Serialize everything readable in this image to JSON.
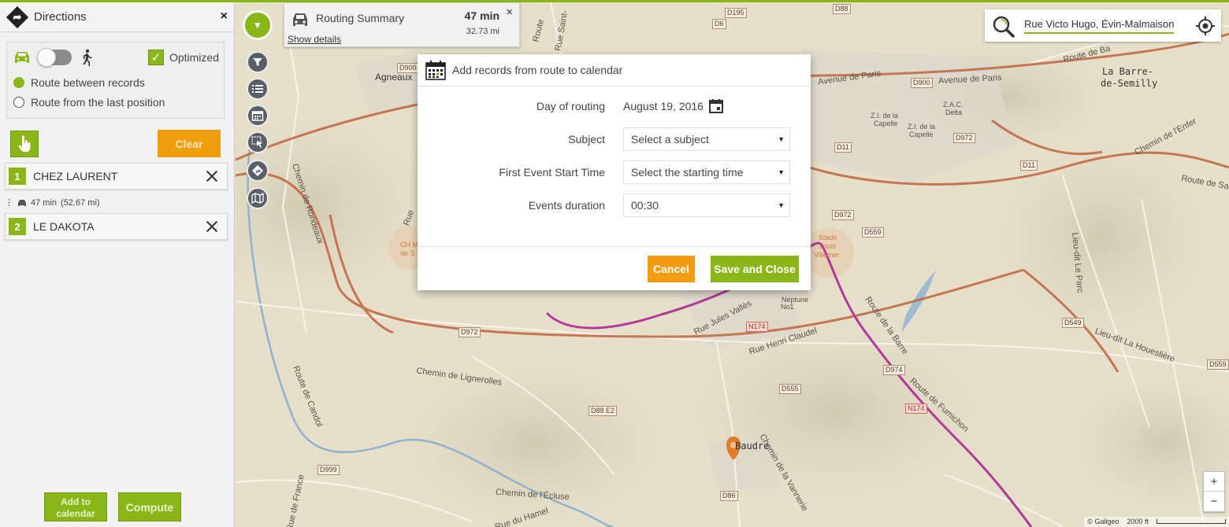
{
  "directions": {
    "title": "Directions",
    "close": "×",
    "optimized_label": "Optimized",
    "optimized_checked": true,
    "route_options": [
      {
        "label": "Route between records",
        "selected": true
      },
      {
        "label": "Route from the last position",
        "selected": false
      }
    ],
    "clear_label": "Clear",
    "stops": [
      {
        "num": "1",
        "name": "CHEZ LAURENT"
      },
      {
        "num": "2",
        "name": "LE DAKOTA"
      }
    ],
    "leg": {
      "time": "47 min",
      "distance": "(52.67 mi)"
    },
    "add_to_calendar_label": "Add to calendar",
    "compute_label": "Compute"
  },
  "routing_summary": {
    "title": "Routing Summary",
    "time": "47 min",
    "distance": "32.73 mi",
    "details_link": "Show details",
    "close": "×"
  },
  "search": {
    "value": "Rue Victo Hugo, Évin-Malmaison, L"
  },
  "modal": {
    "title": "Add records from route to calendar",
    "day_label": "Day of routing",
    "day_value": "August 19, 2016",
    "subject_label": "Subject",
    "subject_value": "Select a subject",
    "start_label": "First Event Start Time",
    "start_value": "Select the starting time",
    "duration_label": "Events duration",
    "duration_value": "00:30",
    "cancel_label": "Cancel",
    "save_label": "Save and Close"
  },
  "map": {
    "labels": {
      "agneaux": "Agneaux",
      "barre": "La Barre-",
      "barre2": "de-Semilly",
      "avenue_paris1": "Avenue de Paris",
      "avenue_paris2": "Avenue de Paris",
      "zac1": "Z.A.C.",
      "zac2": "Delta",
      "zi1a": "Z.I. de la",
      "zi1b": "Capelle",
      "zi2a": "Z.I. de la",
      "zi2b": "Capelle",
      "stade1": "Stade",
      "stade2": "Louis",
      "stade3": "Villemer",
      "neptune1": "Neptune",
      "neptune2": "No1",
      "jules": "Rue Jules Vallès",
      "henri": "Rue Henri Claudel",
      "lignerolles": "Chemin de Lignerolles",
      "candol": "Route de Candol",
      "rondeaux": "Chemin de Rondeaux",
      "baudre": "Baudre",
      "vannerie": "Chemin de la Vannerie",
      "ecluse": "Chemin de l'Écluse",
      "hamel": "Rue du Hamel",
      "france": "Rue de France",
      "fumichon": "Route de Fumichon",
      "barre_route": "Route de la Barre",
      "houesliere": "Lieu-dit La Houeslière",
      "parc": "Lieu-dit Le Parc",
      "enfer": "Chemin de l'Enfer",
      "route_sa": "Route de Sa",
      "route_ba": "Route de Ba",
      "rue_saint": "Rue Saint-",
      "route_top": "Route",
      "chm": "CH M",
      "chm2": "de S",
      "rue": "Rue"
    },
    "roads": {
      "D195": "D195",
      "D6": "D6",
      "D88": "D88",
      "D900a": "D900",
      "D900b": "D900",
      "D11a": "D11",
      "D11b": "D11",
      "D972a": "D972",
      "D972b": "D972",
      "D972c": "D972",
      "D559a": "D559",
      "D549": "D549",
      "D559b": "D559",
      "D974": "D974",
      "N174a": "N174",
      "N174b": "N174",
      "D555": "D555",
      "D88E2": "D88 E2",
      "D999": "D999",
      "D86": "D86"
    },
    "zoom_in": "+",
    "zoom_out": "−",
    "attribution": "© Galigeo",
    "scale": "2000 ft"
  },
  "colors": {
    "accent_green": "#8ab619",
    "accent_orange": "#f39c12",
    "route_magenta": "#b03a9a",
    "road_brown": "#c26a46"
  }
}
